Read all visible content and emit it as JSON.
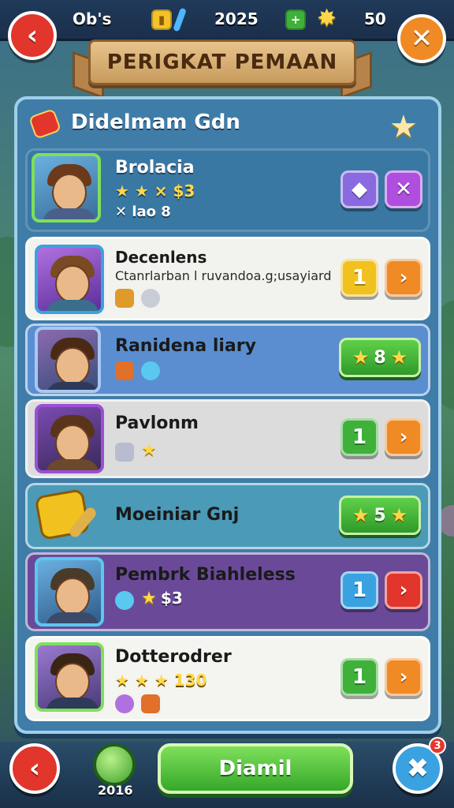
{
  "header": {
    "back_label": "‹",
    "left_label": "Ob's",
    "score": "2025",
    "coins": "50",
    "close_label": "✕"
  },
  "banner": {
    "title": "PERIGKAT PEMAAN"
  },
  "panel": {
    "heading": "Didelmam Gdn"
  },
  "rows": [
    {
      "title": "Brolacia",
      "stats": "★ ★ × $3",
      "sub": "✕ lao 8",
      "btn1": "◆",
      "btn2": "✕"
    },
    {
      "title": "Decenlens",
      "sub": "Ctanrlarban l ruvandoa.g;usayiard"
    },
    {
      "title": "Ranidena liary",
      "pill": "8"
    },
    {
      "title": "Pavlonm",
      "btn1": "1",
      "btn2": "›"
    },
    {
      "title": "Moeiniar Gnj",
      "pill": "5"
    },
    {
      "title": "Pembrk Biahleless",
      "stats": "$3"
    },
    {
      "title": "Dotterodrer",
      "stats": "★ ★ ★ 130",
      "btn1": "1",
      "btn2": "›"
    }
  ],
  "bottom": {
    "level": "2016",
    "main_label": "Diamil",
    "badge": "3"
  },
  "colors": {
    "green": "#3fb13a",
    "orange": "#f08a24",
    "red": "#e2352b",
    "purple": "#9b4fd6",
    "blue": "#3aa2e0",
    "yellow": "#f1c21f"
  }
}
